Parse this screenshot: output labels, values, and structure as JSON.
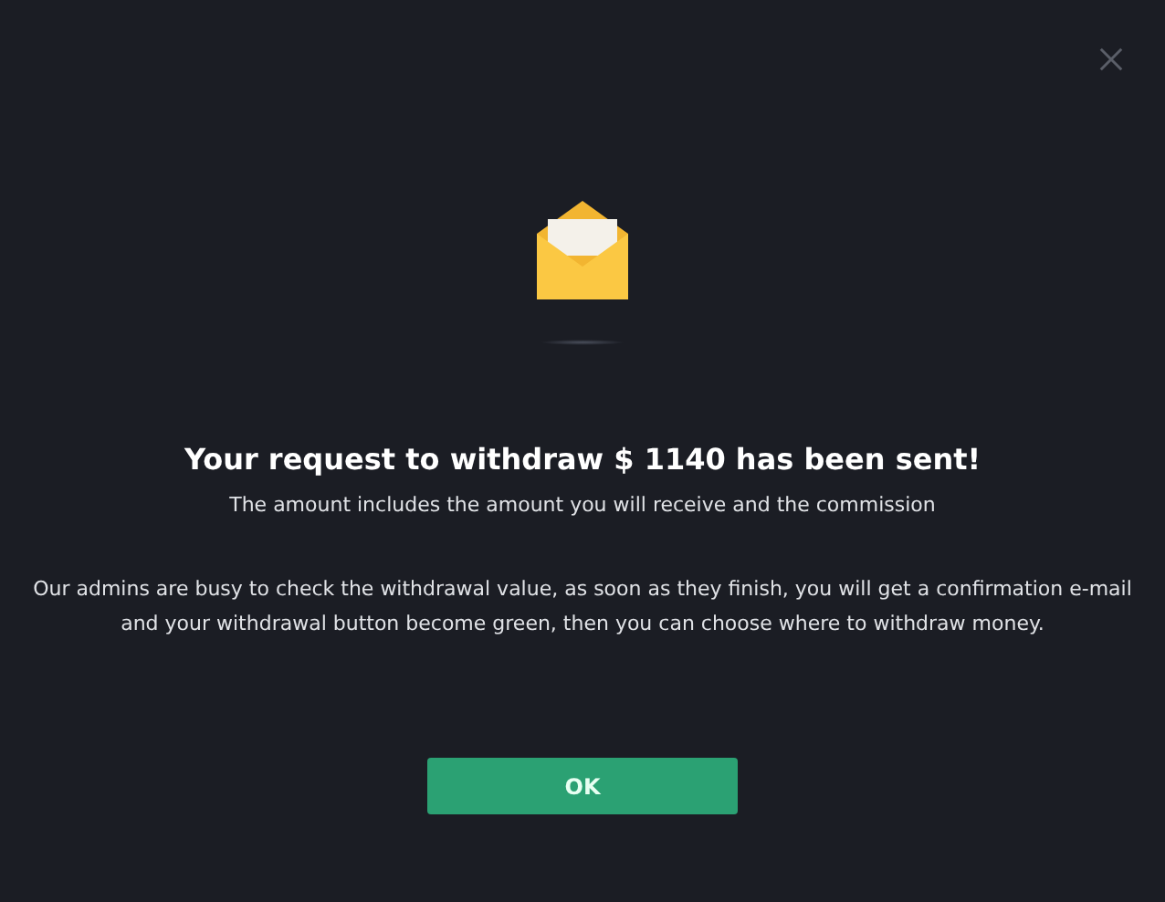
{
  "dialog": {
    "title": "Your request to withdraw $ 1140 has been sent!",
    "subtitle": "The amount includes the amount you will receive and the commission",
    "message": "Our admins are busy to check the withdrawal value, as soon as they finish, you will get a confirmation e-mail and your withdrawal button become green, then you can choose where to withdraw money.",
    "button": "OK"
  }
}
